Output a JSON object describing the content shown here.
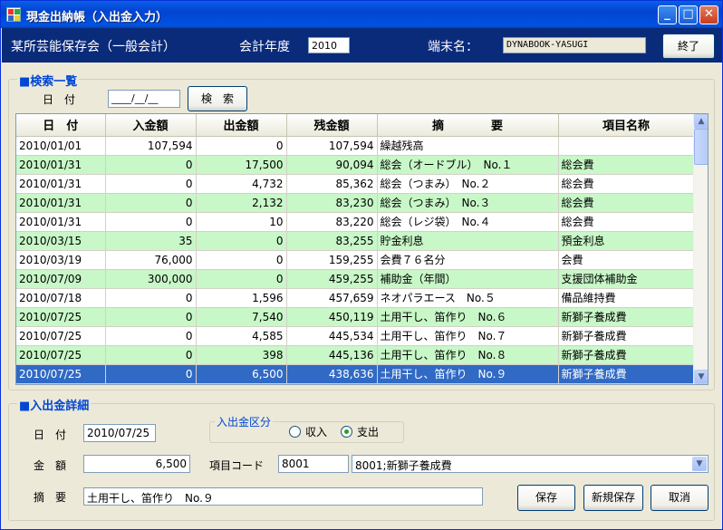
{
  "window": {
    "title": "現金出納帳（入出金入力）"
  },
  "header": {
    "org_name": "某所芸能保存会（一般会計）",
    "fiscal_year_label": "会計年度",
    "fiscal_year_value": "2010",
    "terminal_label": "端末名：",
    "terminal_value": "DYNABOOK-YASUGI",
    "exit_label": "終了"
  },
  "search": {
    "section_title": "■検索一覧",
    "date_label": "日　付",
    "date_value": "____/__/__",
    "search_button": "検　索"
  },
  "grid": {
    "columns": [
      "日　付",
      "入金額",
      "出金額",
      "残金額",
      "摘　　　　要",
      "項目名称"
    ],
    "rows": [
      [
        "2010/01/01",
        "107,594",
        "0",
        "107,594",
        "繰越残高",
        ""
      ],
      [
        "2010/01/31",
        "0",
        "17,500",
        "90,094",
        "総会（オードブル）　No.１",
        "総会費"
      ],
      [
        "2010/01/31",
        "0",
        "4,732",
        "85,362",
        "総会（つまみ）　No.２",
        "総会費"
      ],
      [
        "2010/01/31",
        "0",
        "2,132",
        "83,230",
        "総会（つまみ）　No.３",
        "総会費"
      ],
      [
        "2010/01/31",
        "0",
        "10",
        "83,220",
        "総会（レジ袋）　No.４",
        "総会費"
      ],
      [
        "2010/03/15",
        "35",
        "0",
        "83,255",
        "貯金利息",
        "預金利息"
      ],
      [
        "2010/03/19",
        "76,000",
        "0",
        "159,255",
        "会費７６名分",
        "会費"
      ],
      [
        "2010/07/09",
        "300,000",
        "0",
        "459,255",
        "補助金（年間）",
        "支援団体補助金"
      ],
      [
        "2010/07/18",
        "0",
        "1,596",
        "457,659",
        "ネオパラエース　No.５",
        "備品維持費"
      ],
      [
        "2010/07/25",
        "0",
        "7,540",
        "450,119",
        "土用干し、笛作り　No.６",
        "新獅子養成費"
      ],
      [
        "2010/07/25",
        "0",
        "4,585",
        "445,534",
        "土用干し、笛作り　No.７",
        "新獅子養成費"
      ],
      [
        "2010/07/25",
        "0",
        "398",
        "445,136",
        "土用干し、笛作り　No.８",
        "新獅子養成費"
      ],
      [
        "2010/07/25",
        "0",
        "6,500",
        "438,636",
        "土用干し、笛作り　No.９",
        "新獅子養成費"
      ]
    ],
    "selected_row": 12
  },
  "detail": {
    "section_title": "■入出金詳細",
    "date_label": "日　付",
    "date_value": "2010/07/25",
    "type_group_label": "入出金区分",
    "type_income": "収入",
    "type_expense": "支出",
    "type_selected": "支出",
    "amount_label": "金　額",
    "amount_value": "6,500",
    "item_code_label": "項目コード",
    "item_code_value": "8001",
    "item_combo_value": "8001;新獅子養成費",
    "memo_label": "摘　要",
    "memo_value": "土用干し、笛作り　No.９",
    "save_button": "保存",
    "new_save_button": "新規保存",
    "cancel_button": "取消"
  },
  "colors": {
    "row_alt": "#C8F7C8",
    "row_selected": "#316AC5",
    "header_bar": "#0A2A7A",
    "accent": "#0046D5"
  }
}
